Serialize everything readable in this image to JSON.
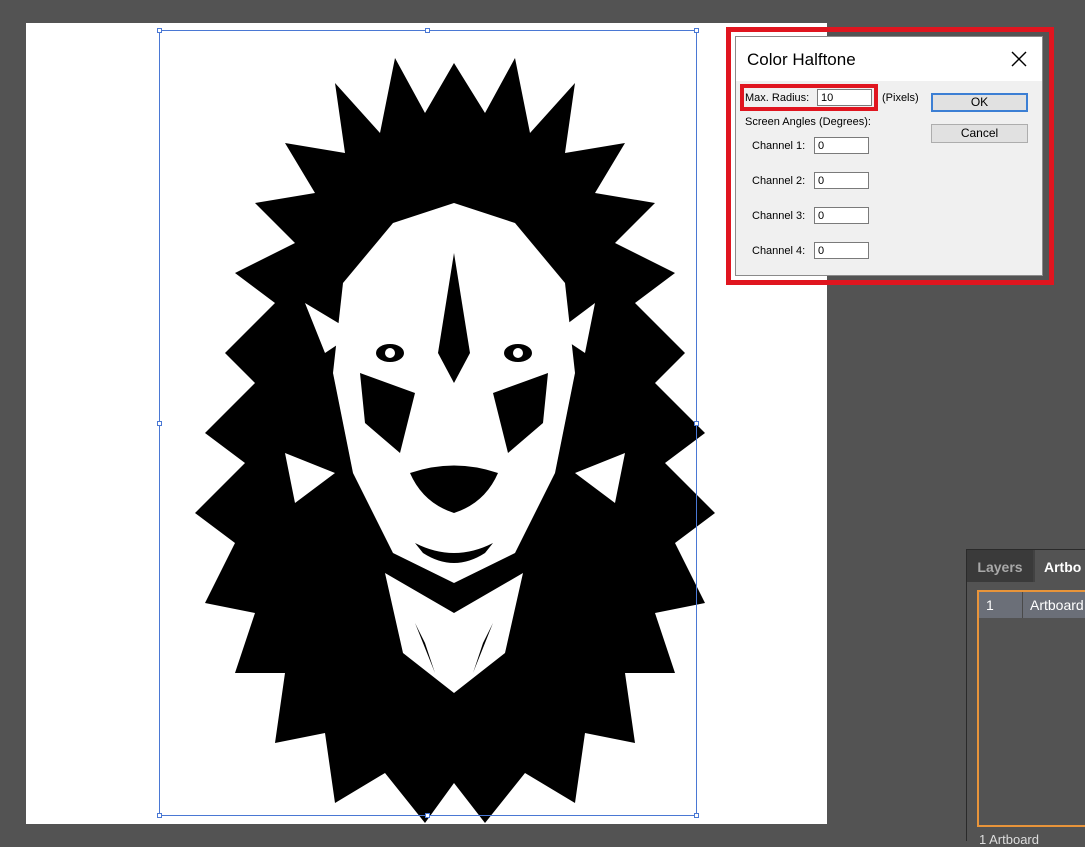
{
  "dialog": {
    "title": "Color Halftone",
    "max_radius_label": "Max. Radius:",
    "max_radius_value": "10",
    "pixels_label": "(Pixels)",
    "screen_angles_label": "Screen Angles (Degrees):",
    "channels": [
      {
        "label": "Channel 1:",
        "value": "0"
      },
      {
        "label": "Channel 2:",
        "value": "0"
      },
      {
        "label": "Channel 3:",
        "value": "0"
      },
      {
        "label": "Channel 4:",
        "value": "0"
      }
    ],
    "ok_label": "OK",
    "cancel_label": "Cancel"
  },
  "panel": {
    "tabs": [
      "Layers",
      "Artbo"
    ],
    "rows": [
      {
        "num": "1",
        "name": "Artboard"
      }
    ],
    "footer": "1 Artboard"
  },
  "colors": {
    "highlight": "#e0151f",
    "selection": "#4a78d4",
    "panel_accent": "#e8943a"
  },
  "icons": [
    "close-icon"
  ]
}
